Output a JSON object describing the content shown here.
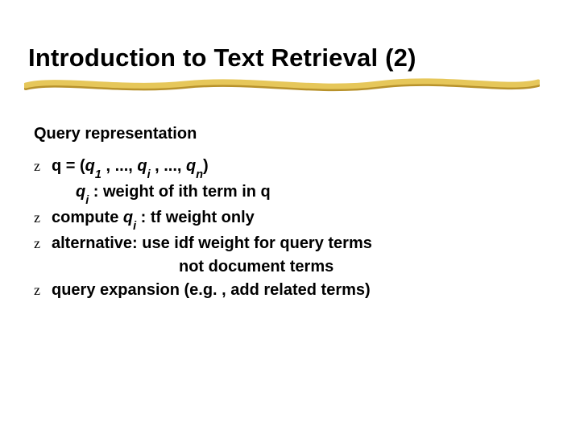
{
  "colors": {
    "underline_main": "#e6c75a",
    "underline_shadow": "#b8922b"
  },
  "title": "Introduction to Text Retrieval (2)",
  "subheading": "Query representation",
  "bullet_glyph": "z",
  "lines": {
    "l1": {
      "pre": "q = (",
      "q": "q",
      "sub1": "1",
      "sep": " , ..., ",
      "subi": "i",
      "subn": "n",
      "close": ")"
    },
    "l1b": {
      "q": "q",
      "subi": "i",
      "rest": " : weight of ith term in q"
    },
    "l2": {
      "pre": "compute ",
      "q": "q",
      "subi": "i",
      "rest": " : tf weight only"
    },
    "l3": {
      "text": "alternative: use idf weight for query terms"
    },
    "l3b": {
      "text": "not document terms"
    },
    "l4": {
      "text": "query expansion (e.g. , add related terms)"
    }
  }
}
